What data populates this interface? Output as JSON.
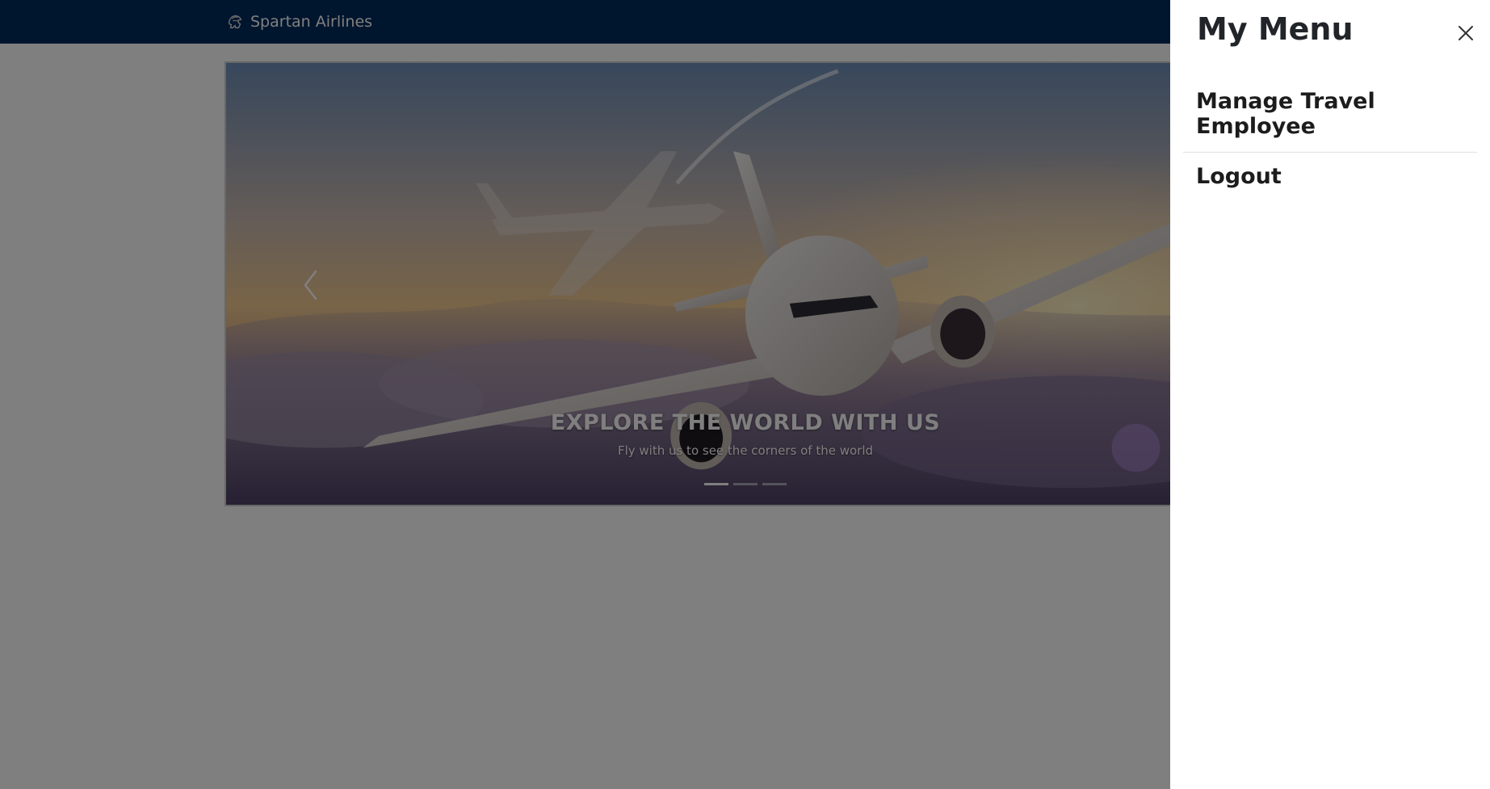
{
  "navbar": {
    "brand_name": "Spartan Airlines",
    "brand_icon": "spartan-helmet-icon",
    "background": "#002b5c"
  },
  "carousel": {
    "slide_title": "EXPLORE THE WORLD WITH US",
    "slide_subtitle": "Fly with us to see the corners of the world",
    "prev_icon": "chevron-left-icon",
    "indicator_count": 3,
    "active_indicator": 1
  },
  "offcanvas": {
    "title": "My Menu",
    "close_icon": "close-icon",
    "items": [
      {
        "label": "Manage Travel Employee"
      },
      {
        "label": "Logout"
      }
    ]
  }
}
